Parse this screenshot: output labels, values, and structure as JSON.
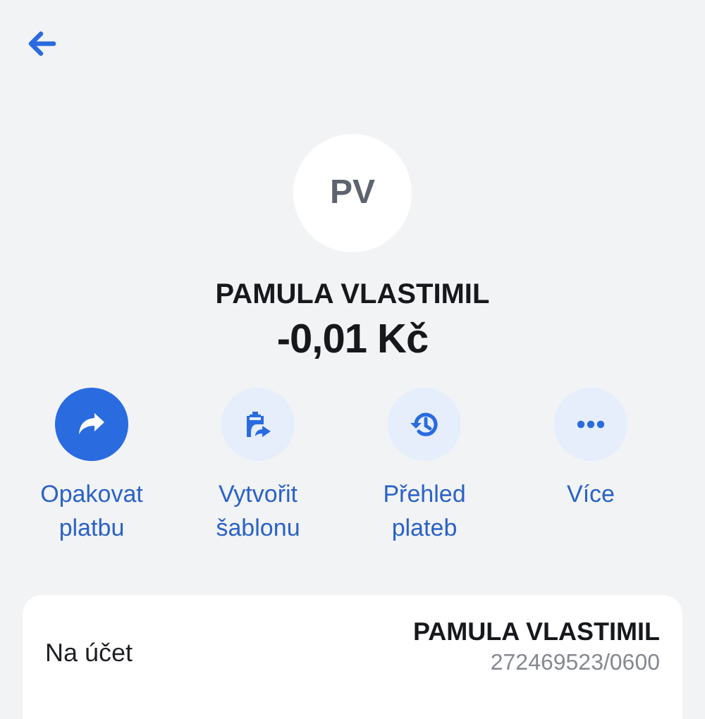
{
  "header": {
    "avatar_initials": "PV",
    "name": "PAMULA VLASTIMIL",
    "amount": "-0,01 Kč"
  },
  "actions": [
    {
      "kind": "repeat",
      "label": "Opakovat platbu",
      "highlighted": true
    },
    {
      "kind": "template",
      "label": "Vytvořit šablonu",
      "highlighted": false
    },
    {
      "kind": "history",
      "label": "Přehled plateb",
      "highlighted": false
    },
    {
      "kind": "more",
      "label": "Více",
      "highlighted": false
    }
  ],
  "details": [
    {
      "label": "Na účet",
      "value": "PAMULA VLASTIMIL",
      "subvalue": "272469523/0600"
    }
  ]
}
